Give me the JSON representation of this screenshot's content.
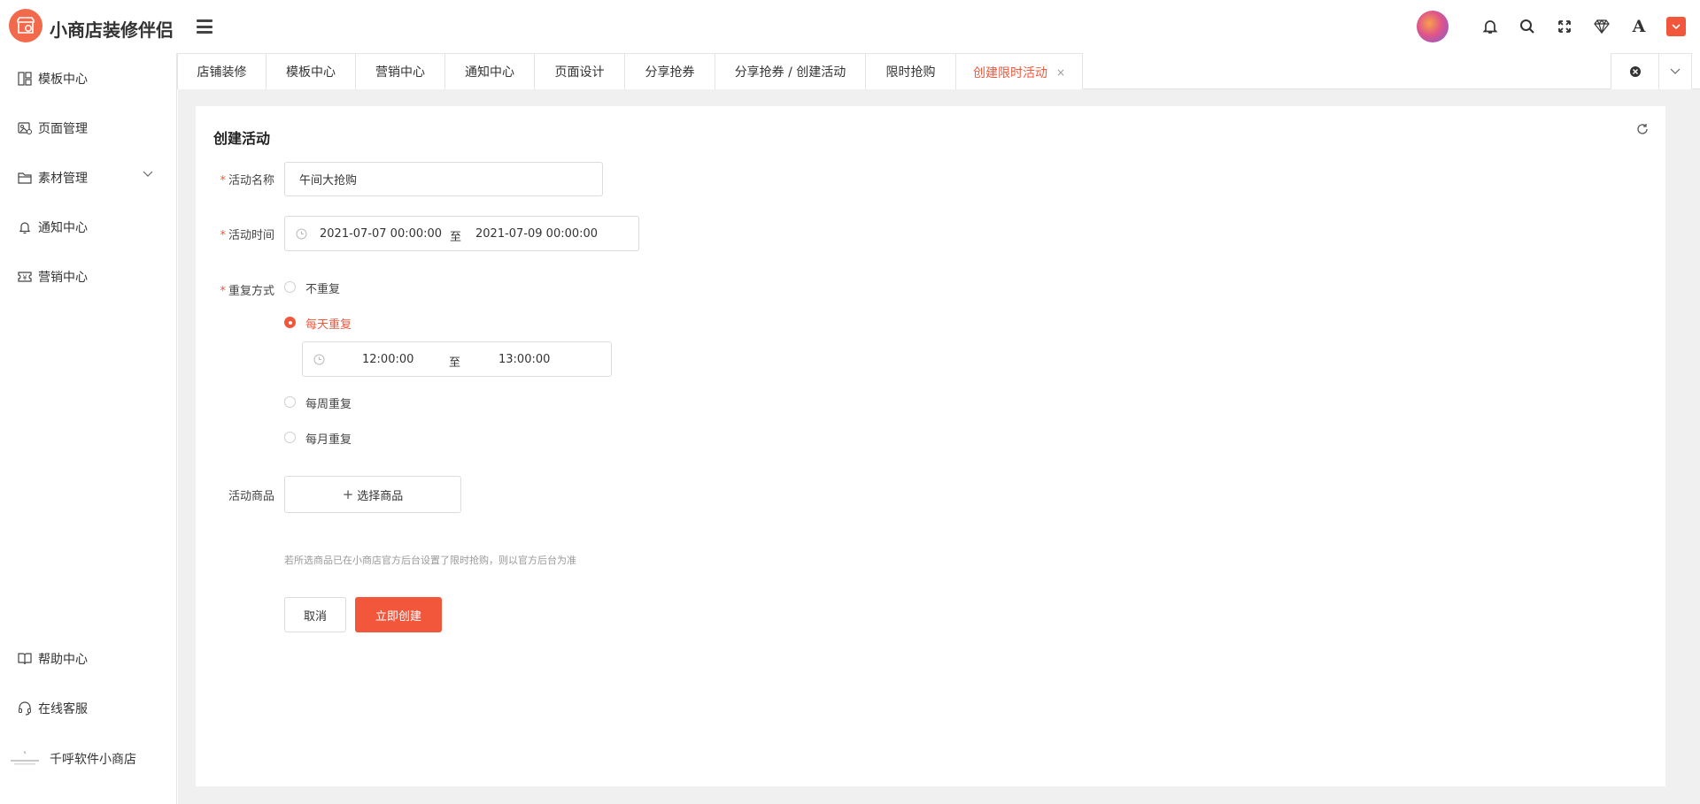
{
  "app": {
    "title": "小商店装修伴侣"
  },
  "sidebar": {
    "items": [
      {
        "label": "模板中心"
      },
      {
        "label": "页面管理"
      },
      {
        "label": "素材管理"
      },
      {
        "label": "通知中心"
      },
      {
        "label": "营销中心"
      }
    ],
    "bottom": [
      {
        "label": "帮助中心"
      },
      {
        "label": "在线客服"
      },
      {
        "label": "千呼软件小商店"
      }
    ]
  },
  "tabs": [
    {
      "label": "店铺装修"
    },
    {
      "label": "模板中心"
    },
    {
      "label": "营销中心"
    },
    {
      "label": "通知中心"
    },
    {
      "label": "页面设计"
    },
    {
      "label": "分享抢券"
    },
    {
      "label": "分享抢券 / 创建活动"
    },
    {
      "label": "限时抢购"
    },
    {
      "label": "创建限时活动",
      "active": true
    }
  ],
  "form": {
    "title": "创建活动",
    "name_label": "活动名称",
    "name_value": "午间大抢购",
    "time_label": "活动时间",
    "time_start": "2021-07-07 00:00:00",
    "time_sep": "至",
    "time_end": "2021-07-09 00:00:00",
    "repeat_label": "重复方式",
    "repeat_options": [
      {
        "label": "不重复",
        "selected": false
      },
      {
        "label": "每天重复",
        "selected": true
      },
      {
        "label": "每周重复",
        "selected": false
      },
      {
        "label": "每月重复",
        "selected": false
      }
    ],
    "daily_start": "12:00:00",
    "daily_sep": "至",
    "daily_end": "13:00:00",
    "goods_label": "活动商品",
    "select_goods": "选择商品",
    "hint": "若所选商品已在小商店官方后台设置了限时抢购，则以官方后台为准",
    "cancel": "取消",
    "submit": "立即创建"
  },
  "colors": {
    "accent": "#f2573c",
    "background": "#f0f0f0"
  }
}
